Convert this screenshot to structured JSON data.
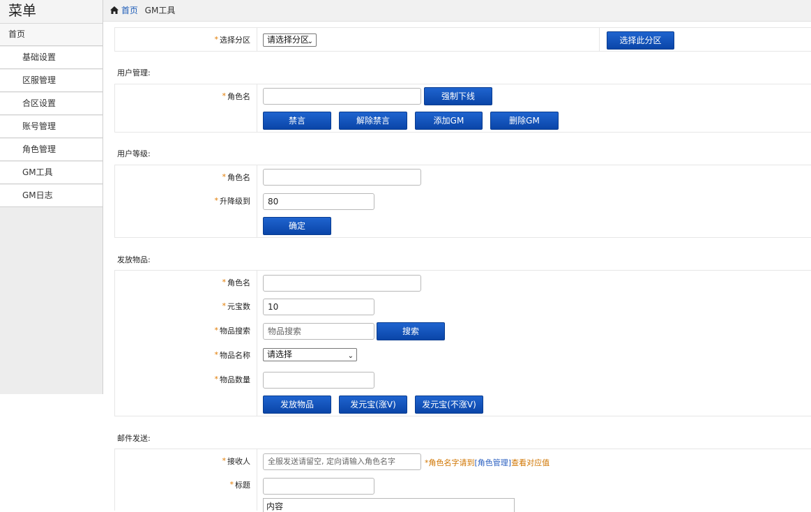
{
  "sidebar": {
    "title": "菜单",
    "home": "首页",
    "items": [
      "基础设置",
      "区服管理",
      "合区设置",
      "账号管理",
      "角色管理",
      "GM工具",
      "GM日志"
    ]
  },
  "breadcrumb": {
    "home": "首页",
    "current": "GM工具"
  },
  "zone": {
    "label": "选择分区",
    "select_value": "请选择分区",
    "button": "选择此分区"
  },
  "user_mgmt": {
    "title": "用户管理:",
    "role_label": "角色名",
    "force_offline": "强制下线",
    "buttons": [
      "禁言",
      "解除禁言",
      "添加GM",
      "删除GM"
    ]
  },
  "user_level": {
    "title": "用户等级:",
    "role_label": "角色名",
    "level_label": "升降级到",
    "level_value": "80",
    "confirm": "确定"
  },
  "items": {
    "title": "发放物品:",
    "role_label": "角色名",
    "ingot_label": "元宝数",
    "ingot_value": "10",
    "search_label": "物品搜索",
    "search_placeholder": "物品搜索",
    "search_button": "搜索",
    "name_label": "物品名称",
    "name_select": "请选择",
    "qty_label": "物品数量",
    "buttons": [
      "发放物品",
      "发元宝(涨V)",
      "发元宝(不涨V)"
    ]
  },
  "mail": {
    "title": "邮件发送:",
    "receiver_label": "接收人",
    "receiver_placeholder": "全服发送请留空, 定向请输入角色名字",
    "note_prefix": "*角色名字请到",
    "note_link": "[角色管理]",
    "note_suffix": "查看对应值",
    "subject_label": "标题",
    "content_placeholder": "内容"
  },
  "colors": {
    "button": "#0a45a8",
    "required": "#e07a00",
    "link": "#1e5db8"
  }
}
